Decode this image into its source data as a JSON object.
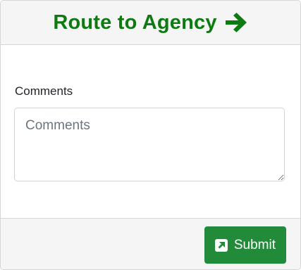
{
  "header": {
    "title": "Route to Agency",
    "icon": "arrow-right-icon",
    "color": "#0e7a12"
  },
  "form": {
    "comments_label": "Comments",
    "comments_placeholder": "Comments",
    "comments_value": ""
  },
  "footer": {
    "submit_label": "Submit",
    "submit_icon": "external-link-square-icon",
    "submit_color": "#228b3a"
  }
}
